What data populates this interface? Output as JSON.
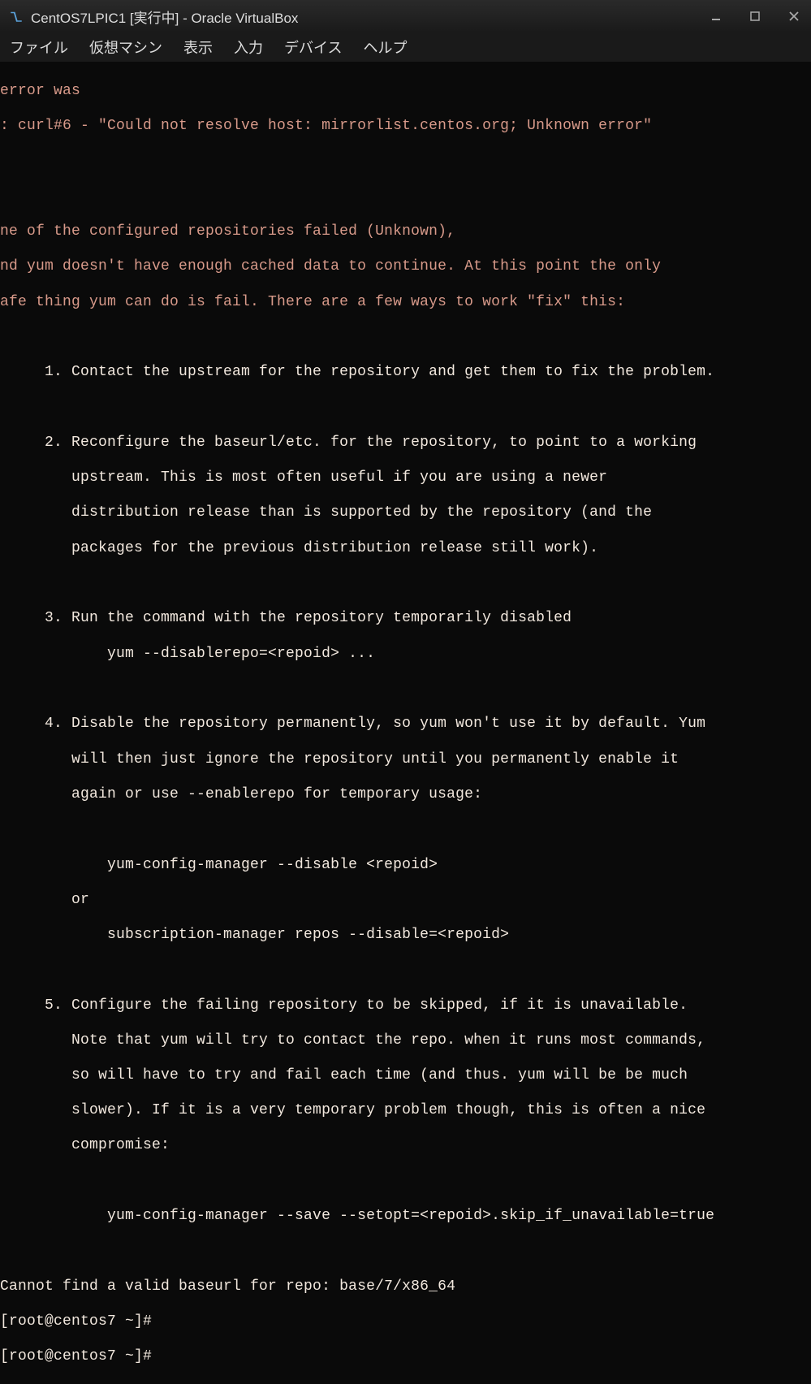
{
  "titlebar": {
    "title": "CentOS7LPIC1 [実行中] - Oracle VirtualBox"
  },
  "menubar": {
    "items": [
      "ファイル",
      "仮想マシン",
      "表示",
      "入力",
      "デバイス",
      "ヘルプ"
    ]
  },
  "terminal": {
    "l_error_was": "error was",
    "l_curl": ": curl#6 - \"Could not resolve host: mirrorlist.centos.org; Unknown error\"",
    "l_one": "ne of the configured repositories failed (Unknown),",
    "l_and": "nd yum doesn't have enough cached data to continue. At this point the only",
    "l_safe": "afe thing yum can do is fail. There are a few ways to work \"fix\" this:",
    "l_1": "     1. Contact the upstream for the repository and get them to fix the problem.",
    "l_2a": "     2. Reconfigure the baseurl/etc. for the repository, to point to a working",
    "l_2b": "        upstream. This is most often useful if you are using a newer",
    "l_2c": "        distribution release than is supported by the repository (and the",
    "l_2d": "        packages for the previous distribution release still work).",
    "l_3a": "     3. Run the command with the repository temporarily disabled",
    "l_3b": "            yum --disablerepo=<repoid> ...",
    "l_4a": "     4. Disable the repository permanently, so yum won't use it by default. Yum",
    "l_4b": "        will then just ignore the repository until you permanently enable it",
    "l_4c": "        again or use --enablerepo for temporary usage:",
    "l_4d": "            yum-config-manager --disable <repoid>",
    "l_4e": "        or",
    "l_4f": "            subscription-manager repos --disable=<repoid>",
    "l_5a": "     5. Configure the failing repository to be skipped, if it is unavailable.",
    "l_5b": "        Note that yum will try to contact the repo. when it runs most commands,",
    "l_5c": "        so will have to try and fail each time (and thus. yum will be be much",
    "l_5d": "        slower). If it is a very temporary problem though, this is often a nice",
    "l_5e": "        compromise:",
    "l_5f": "            yum-config-manager --save --setopt=<repoid>.skip_if_unavailable=true",
    "l_cannot": "Cannot find a valid baseurl for repo: base/7/x86_64",
    "l_prompt1": "[root@centos7 ~]#",
    "l_prompt2": "[root@centos7 ~]#"
  }
}
